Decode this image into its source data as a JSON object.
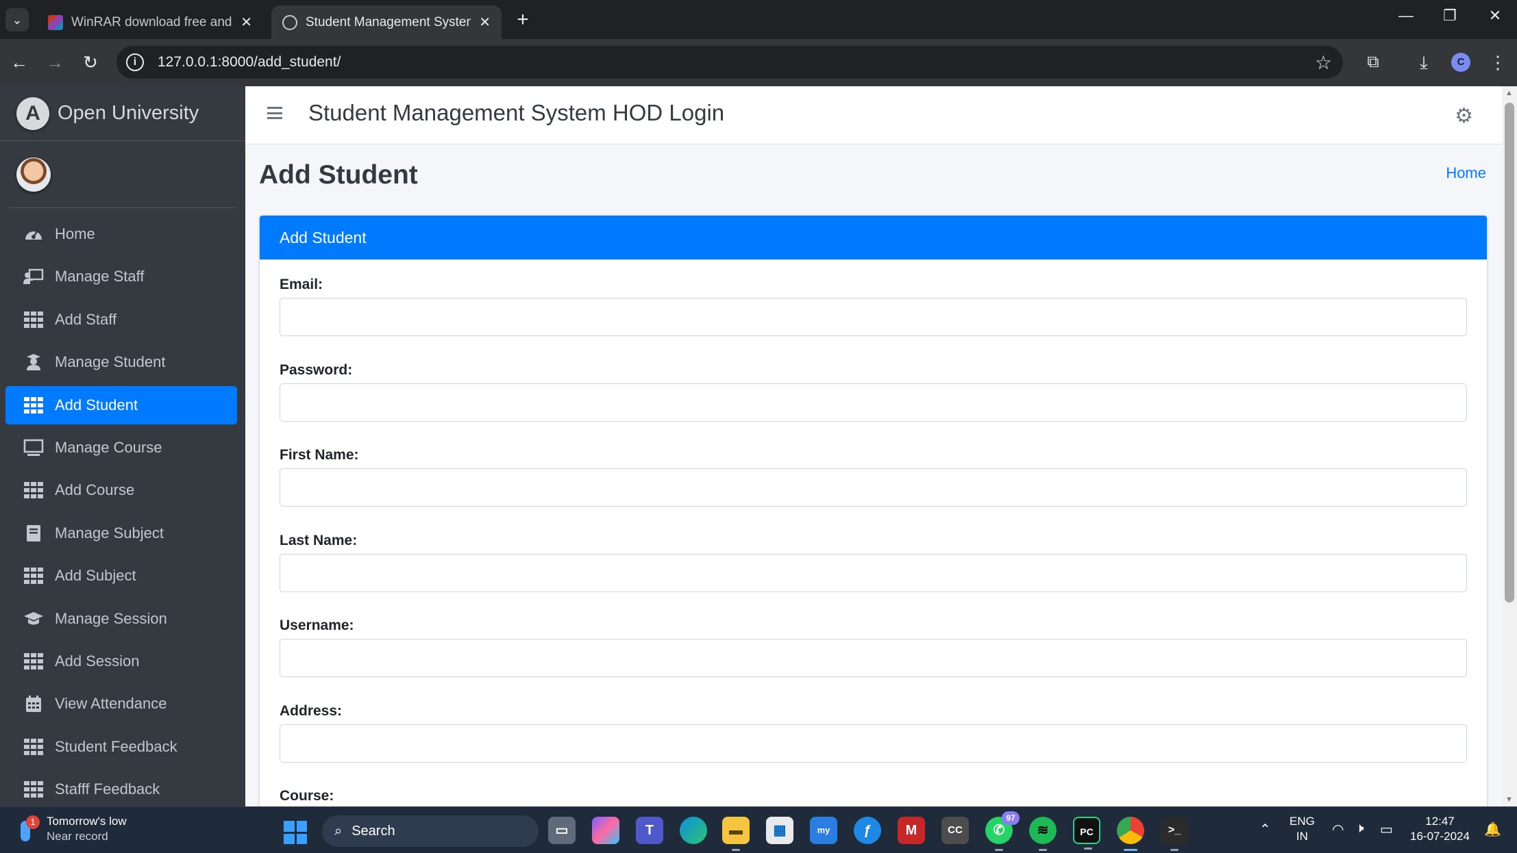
{
  "browser": {
    "tabs": [
      {
        "title": "WinRAR download free and support",
        "active": false
      },
      {
        "title": "Student Management System |",
        "active": true
      }
    ],
    "new_tab": "+",
    "url": "127.0.0.1:8000/add_student/",
    "profile_initial": "C",
    "window_controls": {
      "minimize": "—",
      "restore": "❐",
      "close": "✕"
    }
  },
  "sidebar": {
    "brand_letter": "A",
    "brand": "Open University",
    "items": [
      {
        "label": "Home",
        "icon": "dashboard-icon",
        "active": false
      },
      {
        "label": "Manage Staff",
        "icon": "chalkboard-teacher-icon",
        "active": false
      },
      {
        "label": "Add Staff",
        "icon": "grid-icon",
        "active": false
      },
      {
        "label": "Manage Student",
        "icon": "user-graduate-icon",
        "active": false
      },
      {
        "label": "Add Student",
        "icon": "grid-icon",
        "active": true
      },
      {
        "label": "Manage Course",
        "icon": "monitor-icon",
        "active": false
      },
      {
        "label": "Add Course",
        "icon": "grid-icon",
        "active": false
      },
      {
        "label": "Manage Subject",
        "icon": "book-icon",
        "active": false
      },
      {
        "label": "Add Subject",
        "icon": "grid-icon",
        "active": false
      },
      {
        "label": "Manage Session",
        "icon": "graduation-cap-icon",
        "active": false
      },
      {
        "label": "Add Session",
        "icon": "grid-icon",
        "active": false
      },
      {
        "label": "View Attendance",
        "icon": "calendar-icon",
        "active": false
      },
      {
        "label": "Student Feedback",
        "icon": "grid-icon",
        "active": false
      },
      {
        "label": "Stafff Feedback",
        "icon": "grid-icon",
        "active": false
      }
    ]
  },
  "header": {
    "title": "Student Management System HOD Login"
  },
  "page": {
    "title": "Add Student",
    "breadcrumb": "Home"
  },
  "card": {
    "header": "Add Student",
    "fields": [
      {
        "label": "Email:",
        "value": "",
        "placeholder": ""
      },
      {
        "label": "Password:",
        "value": "",
        "placeholder": ""
      },
      {
        "label": "First Name:",
        "value": "",
        "placeholder": ""
      },
      {
        "label": "Last Name:",
        "value": "",
        "placeholder": ""
      },
      {
        "label": "Username:",
        "value": "",
        "placeholder": ""
      },
      {
        "label": "Address:",
        "value": "",
        "placeholder": ""
      },
      {
        "label": "Course:",
        "value": "",
        "placeholder": ""
      }
    ]
  },
  "taskbar": {
    "weather_badge": "1",
    "weather_title": "Tomorrow's low",
    "weather_sub": "Near record",
    "search": "Search",
    "whatsapp_badge": "97",
    "lang_top": "ENG",
    "lang_bottom": "IN",
    "time": "12:47",
    "date": "16-07-2024"
  },
  "colors": {
    "primary": "#007bff",
    "sidebar_bg": "#343a40",
    "content_bg": "#f4f6f9",
    "browser_dark": "#202124"
  }
}
